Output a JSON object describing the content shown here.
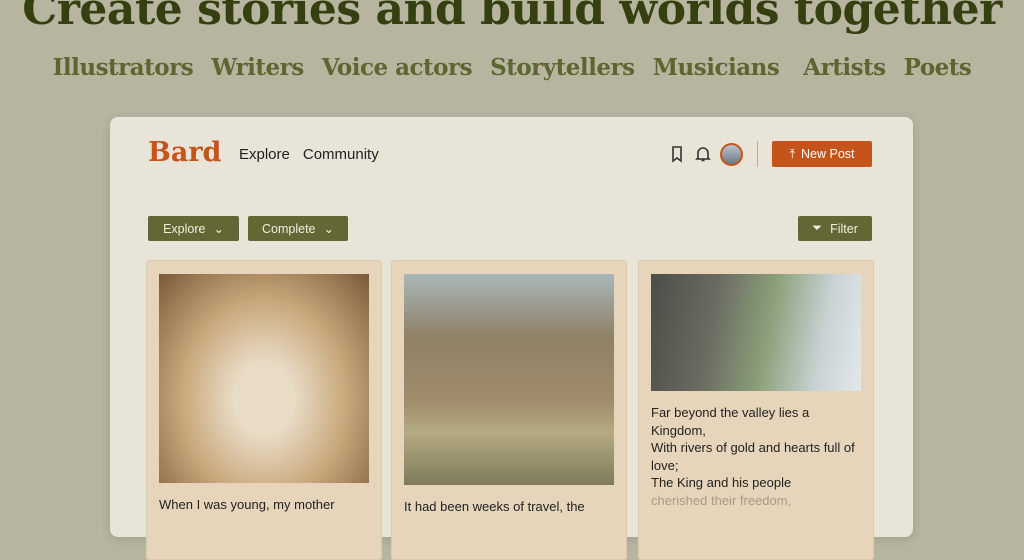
{
  "hero": {
    "title": "Create stories and build worlds together",
    "roles": [
      "Illustrators",
      "Writers",
      "Voice actors",
      "Storytellers",
      "Musicians",
      "Artists",
      "Poets"
    ]
  },
  "header": {
    "logo": "Bard",
    "nav": [
      "Explore",
      "Community"
    ],
    "new_post": "New Post"
  },
  "filters": {
    "explore": "Explore",
    "complete": "Complete",
    "filter": "Filter"
  },
  "cards": [
    {
      "text": "When I was young, my mother"
    },
    {
      "text": "It had been weeks of travel, the"
    },
    {
      "lines": [
        "Far beyond the valley lies a Kingdom,",
        "With rivers of gold and hearts full of love;",
        "The King and his people"
      ],
      "faded": "cherished their freedom,"
    }
  ],
  "colors": {
    "accent": "#c4541a",
    "olive": "#646734",
    "heading": "#353f0f"
  }
}
